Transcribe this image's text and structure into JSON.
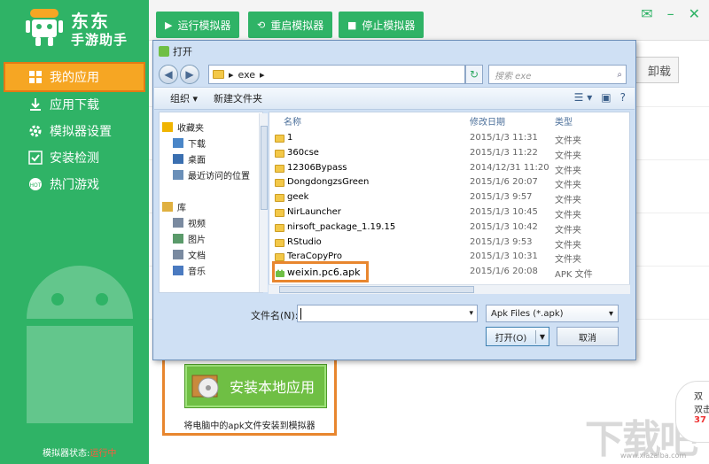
{
  "app": {
    "name_line1": "东东",
    "name_line2": "手游助手"
  },
  "nav": {
    "items": [
      {
        "label": "我的应用",
        "icon": "grid-icon",
        "active": true
      },
      {
        "label": "应用下载",
        "icon": "download-icon",
        "active": false
      },
      {
        "label": "模拟器设置",
        "icon": "gear-icon",
        "active": false
      },
      {
        "label": "安装检测",
        "icon": "check-box-icon",
        "active": false
      },
      {
        "label": "热门游戏",
        "icon": "hot-game-icon",
        "active": false
      }
    ]
  },
  "status": {
    "label": "模拟器状态:",
    "value": "运行中"
  },
  "toolbar": {
    "buttons": [
      {
        "label": "运行模拟器",
        "icon": "play-icon"
      },
      {
        "label": "重启模拟器",
        "icon": "restart-icon"
      },
      {
        "label": "停止模拟器",
        "icon": "stop-icon"
      }
    ]
  },
  "bg": {
    "uninstall_label": "卸载",
    "badge_line1": "双",
    "badge_line2": "双击",
    "badge_num": "37"
  },
  "install": {
    "button_label": "安装本地应用",
    "description": "将电脑中的apk文件安装到模拟器"
  },
  "watermark": {
    "text": "下载吧",
    "sub": "www.xiazaiba.com"
  },
  "dialog": {
    "title": "打开",
    "address_path": "exe",
    "search_placeholder": "搜索 exe",
    "organize_label": "组织 ▾",
    "new_folder_label": "新建文件夹",
    "tree": [
      {
        "label": "收藏夹",
        "level": 0,
        "icon": "star-icon"
      },
      {
        "label": "下载",
        "level": 1,
        "icon": "download-folder-icon"
      },
      {
        "label": "桌面",
        "level": 1,
        "icon": "desktop-icon"
      },
      {
        "label": "最近访问的位置",
        "level": 1,
        "icon": "recent-places-icon"
      },
      {
        "label": "库",
        "level": 0,
        "icon": "library-icon"
      },
      {
        "label": "视频",
        "level": 1,
        "icon": "video-icon"
      },
      {
        "label": "图片",
        "level": 1,
        "icon": "picture-icon"
      },
      {
        "label": "文档",
        "level": 1,
        "icon": "document-icon"
      },
      {
        "label": "音乐",
        "level": 1,
        "icon": "music-icon"
      }
    ],
    "columns": {
      "name": "名称",
      "modified": "修改日期",
      "type": "类型"
    },
    "files": [
      {
        "name": "1",
        "date": "2015/1/3 11:31",
        "type": "文件夹",
        "kind": "folder"
      },
      {
        "name": "360cse",
        "date": "2015/1/3 11:22",
        "type": "文件夹",
        "kind": "folder"
      },
      {
        "name": "12306Bypass",
        "date": "2014/12/31 11:20",
        "type": "文件夹",
        "kind": "folder"
      },
      {
        "name": "DongdongzsGreen",
        "date": "2015/1/6 20:07",
        "type": "文件夹",
        "kind": "folder"
      },
      {
        "name": "geek",
        "date": "2015/1/3 9:57",
        "type": "文件夹",
        "kind": "folder"
      },
      {
        "name": "NirLauncher",
        "date": "2015/1/3 10:45",
        "type": "文件夹",
        "kind": "folder"
      },
      {
        "name": "nirsoft_package_1.19.15",
        "date": "2015/1/3 10:42",
        "type": "文件夹",
        "kind": "folder"
      },
      {
        "name": "RStudio",
        "date": "2015/1/3 9:53",
        "type": "文件夹",
        "kind": "folder"
      },
      {
        "name": "TeraCopyPro",
        "date": "2015/1/3 10:31",
        "type": "文件夹",
        "kind": "folder"
      },
      {
        "name": "weixin.pc6.apk",
        "date": "2015/1/6 20:08",
        "type": "APK 文件",
        "kind": "apk"
      }
    ],
    "filename_label": "文件名(N):",
    "filename_value": "",
    "filter_value": "Apk Files (*.apk)",
    "open_label": "打开(O)",
    "cancel_label": "取消"
  },
  "colors": {
    "green": "#2fb366",
    "orange": "#e8862e",
    "active_nav": "#f6a623"
  }
}
